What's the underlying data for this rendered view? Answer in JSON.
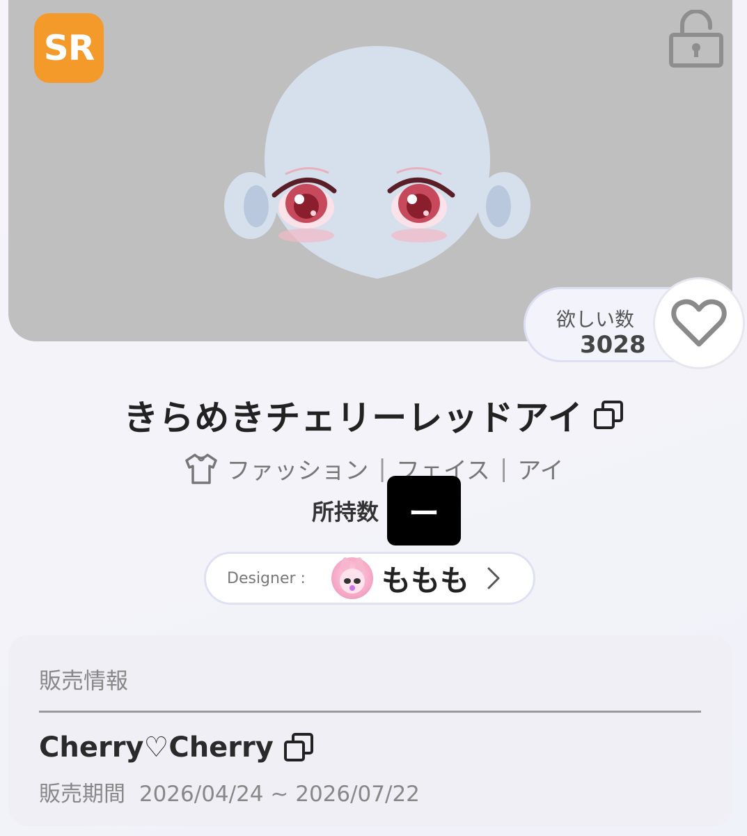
{
  "item": {
    "rarity": "SR",
    "title": "きらめきチェリーレッドアイ",
    "categories": [
      "ファッション",
      "フェイス",
      "アイ"
    ],
    "category_separator": "|",
    "owned_label": "所持数",
    "owned_value": "ー"
  },
  "wishlist": {
    "label": "欲しい数",
    "count": "3028"
  },
  "designer": {
    "label": "Designer :",
    "name": "ももも"
  },
  "sale_info": {
    "header": "販売情報",
    "event_name": "Cherry♡Cherry",
    "period_label": "販売期間",
    "period_value": "2026/04/24 ~ 2026/07/22"
  },
  "colors": {
    "rarity_badge": "#f39a2b",
    "preview_bg": "#bfbfbf",
    "face_skin": "#d6e0ed"
  },
  "icons": {
    "lock": "unlocked-padlock-icon",
    "heart": "heart-outline-icon",
    "copy": "copy-icon",
    "shirt": "shirt-icon",
    "chevron": "chevron-right-icon"
  }
}
